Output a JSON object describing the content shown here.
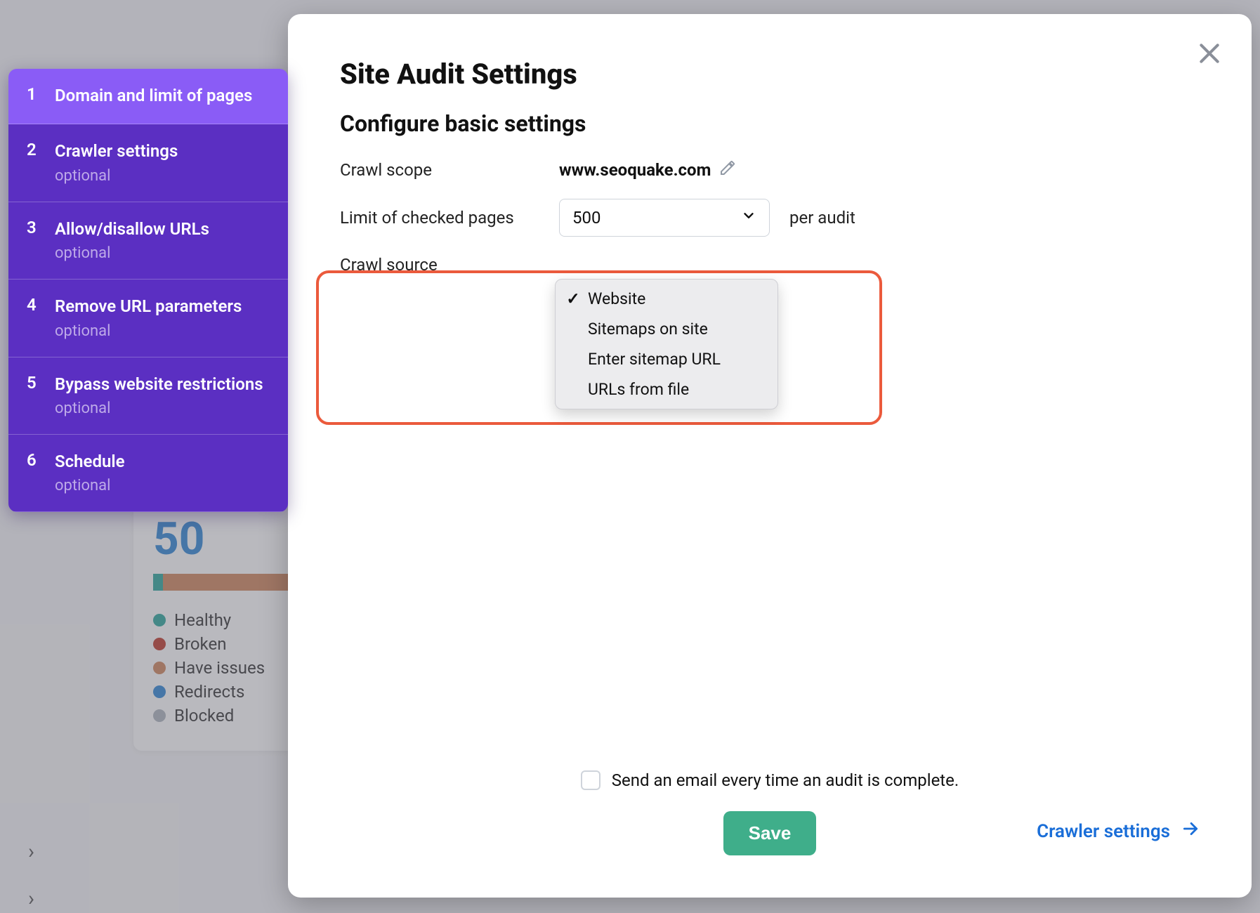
{
  "modal": {
    "title": "Site Audit Settings",
    "subtitle": "Configure basic settings",
    "crawl_scope_label": "Crawl scope",
    "crawl_scope_value": "www.seoquake.com",
    "limit_label": "Limit of checked pages",
    "limit_value": "500",
    "limit_suffix": "per audit",
    "crawl_source_label": "Crawl source",
    "dropdown": {
      "selected": "Website",
      "options": [
        "Website",
        "Sitemaps on site",
        "Enter sitemap URL",
        "URLs from file"
      ]
    },
    "email_label": "Send an email every time an audit is complete.",
    "save_label": "Save",
    "next_label": "Crawler settings"
  },
  "sidebar": {
    "items": [
      {
        "num": "1",
        "title": "Domain and limit of pages",
        "sub": "",
        "active": true
      },
      {
        "num": "2",
        "title": "Crawler settings",
        "sub": "optional",
        "active": false
      },
      {
        "num": "3",
        "title": "Allow/disallow URLs",
        "sub": "optional",
        "active": false
      },
      {
        "num": "4",
        "title": "Remove URL parameters",
        "sub": "optional",
        "active": false
      },
      {
        "num": "5",
        "title": "Bypass website restrictions",
        "sub": "optional",
        "active": false
      },
      {
        "num": "6",
        "title": "Schedule",
        "sub": "optional",
        "active": false
      }
    ]
  },
  "under": {
    "big_number": "50",
    "legend": [
      "Healthy",
      "Broken",
      "Have issues",
      "Redirects",
      "Blocked"
    ]
  }
}
